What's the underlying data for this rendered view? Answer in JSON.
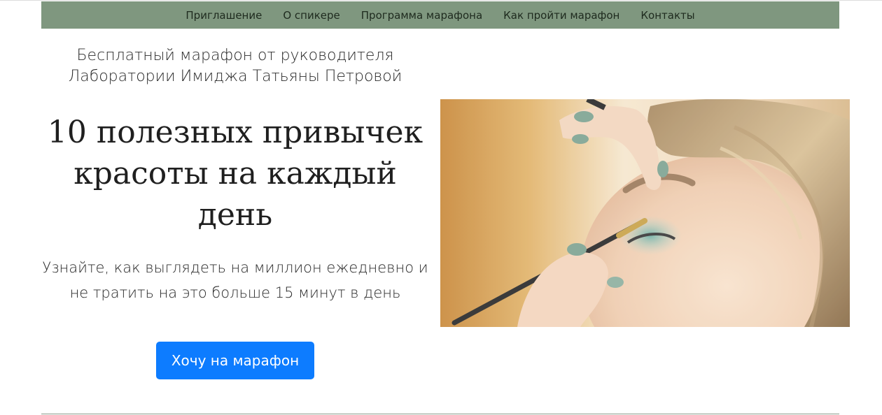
{
  "nav": {
    "items": [
      {
        "label": "Приглашение"
      },
      {
        "label": "О спикере"
      },
      {
        "label": "Программа марафона"
      },
      {
        "label": "Как пройти марафон"
      },
      {
        "label": "Контакты"
      }
    ],
    "background_color": "#7f977f"
  },
  "hero": {
    "subtitle": "Бесплатный марафон от руководителя Лаборатории Имиджа Татьяны Петровой",
    "headline": "10 полезных привычек красоты на каждый день",
    "lead": "Узнайте, как выглядеть на миллион ежедневно и не тратить на это больше 15 минут в день",
    "cta_label": "Хочу на марафон",
    "cta_color": "#0d7cff",
    "photo": {
      "icon": "makeup-eyeshadow-photo"
    }
  }
}
